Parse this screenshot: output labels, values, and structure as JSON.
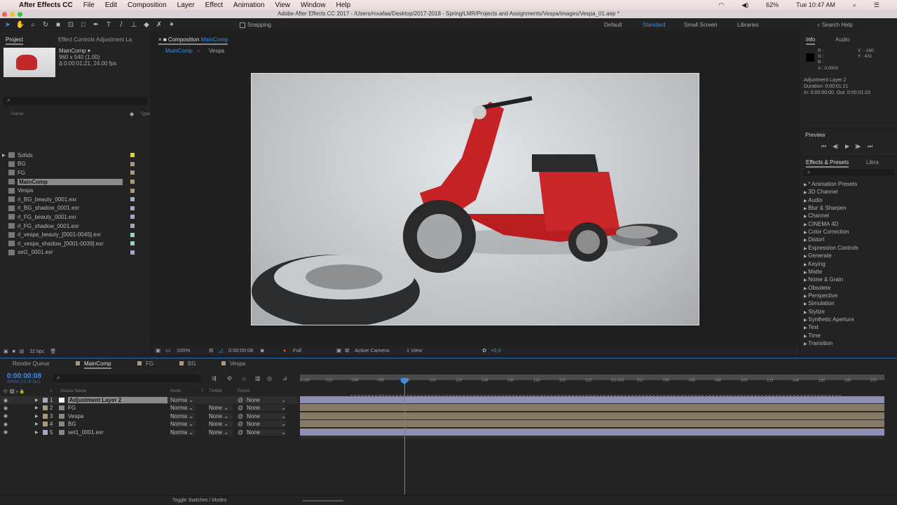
{
  "menubar": {
    "app": "After Effects CC",
    "items": [
      "File",
      "Edit",
      "Composition",
      "Layer",
      "Effect",
      "Animation",
      "View",
      "Window",
      "Help"
    ],
    "battery": "62%",
    "clock": "Tue 10:47 AM"
  },
  "window_title": "Adobe After Effects CC 2017 - /Users/mxafaa/Desktop/2017-2018 - Spring/LMR/Projects and Assignments/Vespa/images/Vespa_01.aep *",
  "toolbar": {
    "snapping": "Snapping",
    "workspaces": [
      "Default",
      "Standard",
      "Small Screen",
      "Libraries"
    ],
    "active_workspace": "Standard",
    "search_help": "Search Help"
  },
  "project": {
    "tab": "Project",
    "effect_controls_tab": "Effect Controls Adjustment La",
    "selected_name": "MainComp ▾",
    "dims": "960 x 540 (1.00)",
    "duration": "Δ 0:00:01:21, 24.00 fps",
    "col_name": "Name",
    "col_type": "Type",
    "items": [
      {
        "name": "Solids",
        "color": "#d9d33a"
      },
      {
        "name": "BG",
        "color": "#a89a7a"
      },
      {
        "name": "FG",
        "color": "#a89a7a"
      },
      {
        "name": "MainComp",
        "color": "#a89a7a"
      },
      {
        "name": "Vespa",
        "color": "#a89a7a"
      },
      {
        "name": "rl_BG_beauty_0001.exr",
        "color": "#a9a6c8"
      },
      {
        "name": "rl_BG_shadow_0001.exr",
        "color": "#a9a6c8"
      },
      {
        "name": "rl_FG_beauty_0001.exr",
        "color": "#a9a6c8"
      },
      {
        "name": "rl_FG_shadow_0001.exr",
        "color": "#a9a6c8"
      },
      {
        "name": "rl_vespa_beauty_[0001-0045].exr",
        "color": "#9ccfc3"
      },
      {
        "name": "rl_vespa_shadow_[0001-0039].exr",
        "color": "#9ccfc3"
      },
      {
        "name": "set1_0001.exr",
        "color": "#a9a6c8"
      }
    ],
    "selected_index": 3,
    "bpc": "32 bpc"
  },
  "composition": {
    "tab_prefix": "Composition",
    "tab_name": "MainComp",
    "breadcrumb": [
      "MainComp",
      "Vespa"
    ],
    "zoom": "100%",
    "timecode": "0:00:00:08",
    "resolution": "Full",
    "camera": "Active Camera",
    "views": "1 View",
    "exposure": "+0.0"
  },
  "info": {
    "tab": "Info",
    "audio_tab": "Audio",
    "r": "R :",
    "g": "G :",
    "b": "B :",
    "a": "A : 0.0000",
    "x": "X : -160",
    "y": "Y : 431",
    "layer": "Adjustment Layer 2",
    "duration": "Duration: 0:00:01:21",
    "inout": "In: 0:00:00:00, Out: 0:00:01:20"
  },
  "preview": {
    "tab": "Preview"
  },
  "effects": {
    "tab": "Effects & Presets",
    "libraries_tab": "Libra",
    "items": [
      "* Animation Presets",
      "3D Channel",
      "Audio",
      "Blur & Sharpen",
      "Channel",
      "CINEMA 4D",
      "Color Correction",
      "Distort",
      "Expression Controls",
      "Generate",
      "Keying",
      "Matte",
      "Noise & Grain",
      "Obsolete",
      "Perspective",
      "Simulation",
      "Stylize",
      "Synthetic Aperture",
      "Text",
      "Time",
      "Transition"
    ]
  },
  "timeline": {
    "tabs": [
      "Render Queue",
      "MainComp",
      "FG",
      "BG",
      "Vespa"
    ],
    "active_tab": "MainComp",
    "timecode": "0:00:00:08",
    "frames": "00008 (24.00 fps)",
    "headers": {
      "source": "Source Name",
      "mode": "Mode",
      "t": "T",
      "trkmat": "TrkMat",
      "parent": "Parent",
      "num": "#"
    },
    "layers": [
      {
        "num": "1",
        "name": "Adjustment Layer 2",
        "mode": "Norma",
        "trkmat": "",
        "parent": "None",
        "color": "#a9a6c8",
        "bar": "#8f8fb4"
      },
      {
        "num": "2",
        "name": "FG",
        "mode": "Norma",
        "trkmat": "None",
        "parent": "None",
        "color": "#a89a7a",
        "bar": "#857a65"
      },
      {
        "num": "3",
        "name": "Vespa",
        "mode": "Norma",
        "trkmat": "None",
        "parent": "None",
        "color": "#a89a7a",
        "bar": "#857a65"
      },
      {
        "num": "4",
        "name": "BG",
        "mode": "Norma",
        "trkmat": "None",
        "parent": "None",
        "color": "#a89a7a",
        "bar": "#857a65"
      },
      {
        "num": "5",
        "name": "set1_0001.exr",
        "mode": "Norma",
        "trkmat": "None",
        "parent": "None",
        "color": "#a9a6c8",
        "bar": "#8f8fb4"
      }
    ],
    "ruler": [
      "0:00f",
      "02f",
      "04f",
      "06f",
      "08f",
      "10f",
      "12f",
      "14f",
      "16f",
      "18f",
      "20f",
      "22f",
      "01:00f",
      "02f",
      "04f",
      "06f",
      "08f",
      "10f",
      "12f",
      "14f",
      "16f",
      "18f",
      "20f"
    ],
    "current_frame": 8,
    "toggle_label": "Toggle Switches / Modes"
  }
}
